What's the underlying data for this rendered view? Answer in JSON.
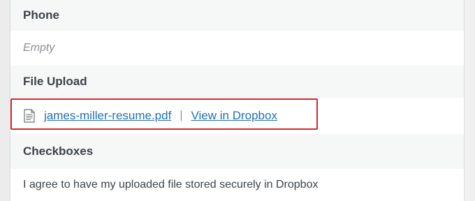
{
  "fields": {
    "phone": {
      "label": "Phone",
      "value": "Empty"
    },
    "file_upload": {
      "label": "File Upload",
      "file_icon": "document-icon",
      "file_name": "james-miller-resume.pdf",
      "separator": "|",
      "dropbox_link": "View in Dropbox"
    },
    "checkboxes": {
      "label": "Checkboxes",
      "value": "I agree to have my uploaded file stored securely in Dropbox"
    }
  },
  "colors": {
    "link": "#2271b1",
    "highlight_border": "#d7282f",
    "label_background": "#f6f7f7"
  }
}
